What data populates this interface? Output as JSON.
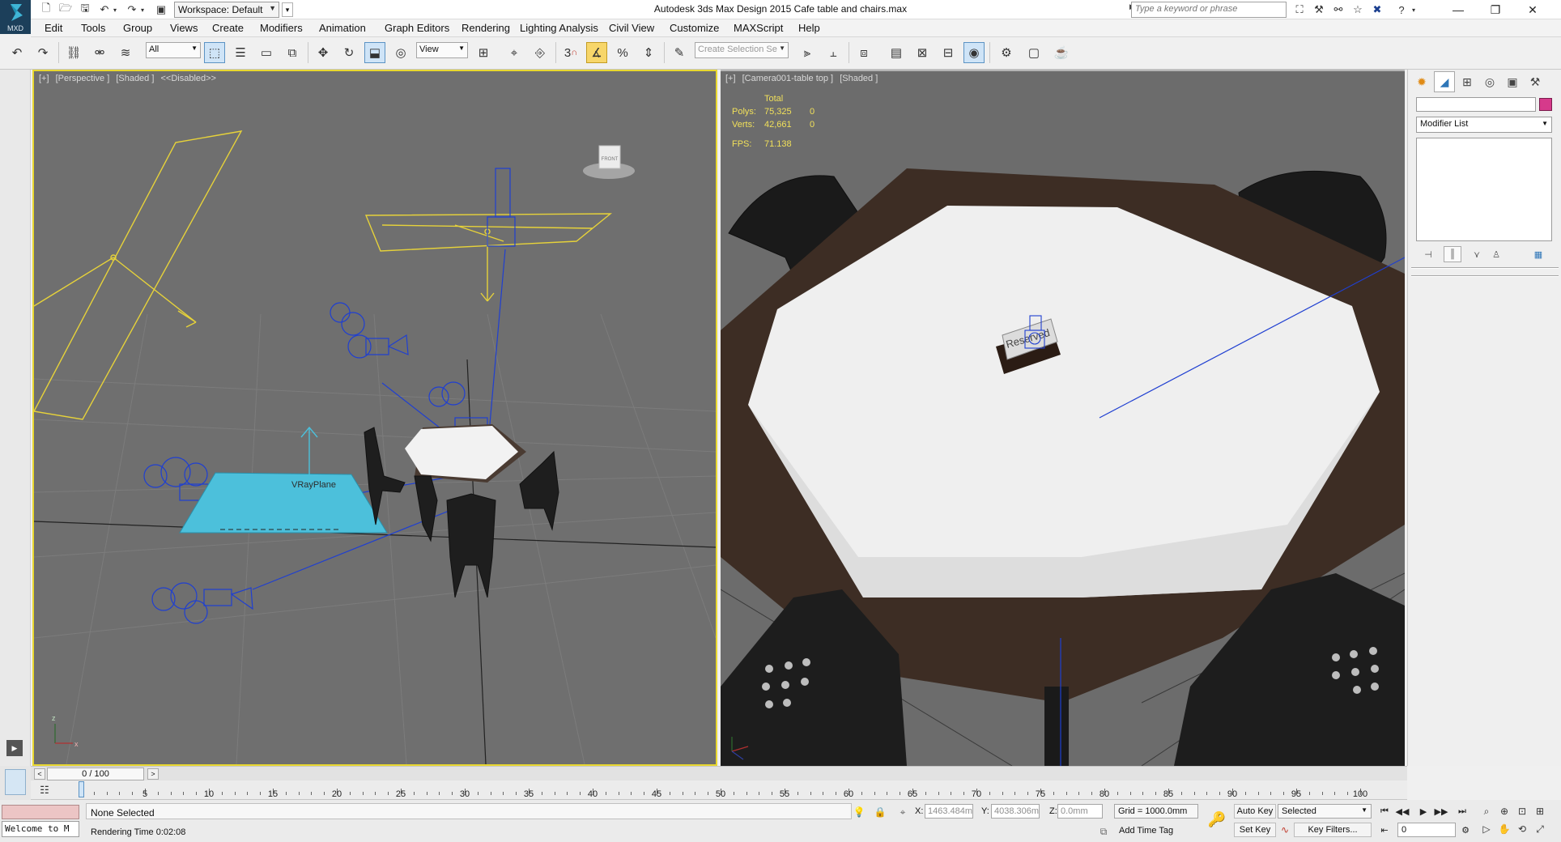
{
  "titlebar": {
    "app_badge": "MXD",
    "workspace": "Workspace: Default",
    "title": "Autodesk 3ds Max Design 2015     Cafe table and chairs.max",
    "search_placeholder": "Type a keyword or phrase"
  },
  "menu": [
    "Edit",
    "Tools",
    "Group",
    "Views",
    "Create",
    "Modifiers",
    "Animation",
    "Graph Editors",
    "Rendering",
    "Lighting Analysis",
    "Civil View",
    "Customize",
    "MAXScript",
    "Help"
  ],
  "toolbar": {
    "selection_filter": "All",
    "ref_coord": "View",
    "snaps_label": "3",
    "named_selection_placeholder": "Create Selection Se"
  },
  "viewport_left": {
    "label_parts": [
      "[+]",
      "[Perspective ]",
      "[Shaded ]",
      "<<Disabled>>"
    ],
    "viewcube_face": "FRONT",
    "object_label": "VRayPlane",
    "axis_x": "x",
    "axis_z": "z"
  },
  "viewport_right": {
    "label_parts": [
      "[+]",
      "[Camera001-table top ]",
      "[Shaded ]"
    ],
    "stats": {
      "header": "Total",
      "polys_label": "Polys:",
      "polys_total": "75,325",
      "polys_sel": "0",
      "verts_label": "Verts:",
      "verts_total": "42,661",
      "verts_sel": "0",
      "fps_label": "FPS:",
      "fps_value": "71.138"
    },
    "sign_text": "Reserved"
  },
  "command_panel": {
    "modifier_list": "Modifier List",
    "object_color": "#d63a8b"
  },
  "time_slider": {
    "position": "0 / 100"
  },
  "trackbar": {
    "ticks": [
      "0",
      "5",
      "10",
      "15",
      "20",
      "25",
      "30",
      "35",
      "40",
      "45",
      "50",
      "55",
      "60",
      "65",
      "70",
      "75",
      "80",
      "85",
      "90",
      "95",
      "100"
    ]
  },
  "status": {
    "listener": "Welcome to M",
    "selection": "None Selected",
    "prompt": "Rendering Time  0:02:08",
    "x_label": "X:",
    "x_value": "1463.484m",
    "y_label": "Y:",
    "y_value": "4038.306m",
    "z_label": "Z:",
    "z_value": "0.0mm",
    "grid": "Grid = 1000.0mm",
    "add_time_tag": "Add Time Tag",
    "auto_key": "Auto Key",
    "set_key": "Set Key",
    "selected": "Selected",
    "key_filters": "Key Filters...",
    "frame": "0"
  },
  "colors": {
    "viewport_bg": "#6f6f6f",
    "active_border": "#e9d830",
    "light_gizmo": "#e6d23a",
    "wire_blue": "#1f3fd1",
    "vray_plane": "#4cc0db"
  }
}
